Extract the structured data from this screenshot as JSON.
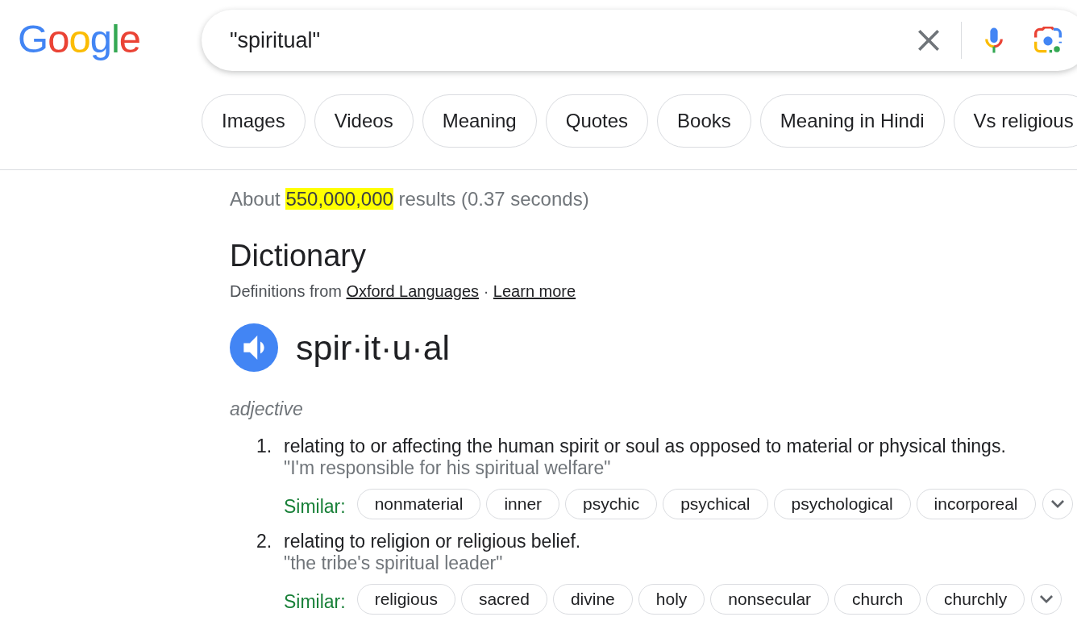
{
  "logo": {
    "text": "Google"
  },
  "search": {
    "value": "\"spiritual\""
  },
  "chips": [
    {
      "label": "Images"
    },
    {
      "label": "Videos"
    },
    {
      "label": "Meaning"
    },
    {
      "label": "Quotes"
    },
    {
      "label": "Books"
    },
    {
      "label": "Meaning in Hindi"
    },
    {
      "label": "Vs religious"
    }
  ],
  "result_stats": [
    {
      "text": "About ",
      "highlighted": false
    },
    {
      "text": "550,000,000",
      "highlighted": true
    },
    {
      "text": " results (0.37 seconds)",
      "highlighted": false
    }
  ],
  "dictionary": {
    "title": "Dictionary",
    "source": {
      "prefix": "Definitions from",
      "source_link": "Oxford Languages",
      "separator": "·",
      "learn_more": "Learn more"
    },
    "word": "spir·it·u·al",
    "part_of_speech": "adjective",
    "senses": [
      {
        "number": "1.",
        "definition": "relating to or affecting the human spirit or soul as opposed to material or physical things.",
        "example": "\"I'm responsible for his spiritual welfare\"",
        "similar_label": "Similar:",
        "similar": [
          "nonmaterial",
          "inner",
          "psychic",
          "psychical",
          "psychological",
          "incorporeal"
        ]
      },
      {
        "number": "2.",
        "definition": "relating to religion or religious belief.",
        "example": "\"the tribe's spiritual leader\"",
        "similar_label": "Similar:",
        "similar": [
          "religious",
          "sacred",
          "divine",
          "holy",
          "nonsecular",
          "church",
          "churchly"
        ]
      }
    ]
  }
}
